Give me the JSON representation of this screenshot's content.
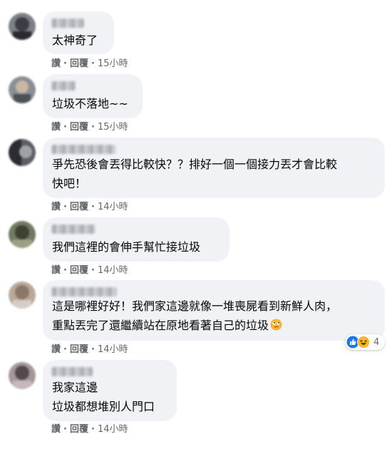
{
  "actions": {
    "like": "讚",
    "separator": "·",
    "reply": "回覆"
  },
  "comments": [
    {
      "text": "太神奇了",
      "time": "15小時"
    },
    {
      "text": "垃圾不落地~~",
      "time": "15小時"
    },
    {
      "lines": [
        "爭先恐後會丟得比較快？？排好一個一個接力丟才會比較",
        "快吧！"
      ],
      "time": "14小時"
    },
    {
      "text": "我們這裡的會伸手幫忙接垃圾",
      "time": "14小時"
    },
    {
      "lines": [
        "這是哪裡好好！我們家這邊就像一堆喪屍看到新鮮人肉，",
        "重點丟完了還繼續站在原地看著自己的垃圾"
      ],
      "emoji": "face-with-rolling-eyes-emoji",
      "time": "14小時",
      "reactions": {
        "icons": [
          "like-reaction-icon",
          "haha-reaction-icon"
        ],
        "count": "4"
      }
    },
    {
      "lines": [
        "我家這邊",
        "垃圾都想堆別人門口"
      ],
      "time": "14小時"
    }
  ],
  "colors": {
    "bubble": "#f0f2f5",
    "text": "#050505",
    "meta": "#65676b",
    "like_blue": "#1877f2",
    "haha_yellow": "#f7b928"
  }
}
